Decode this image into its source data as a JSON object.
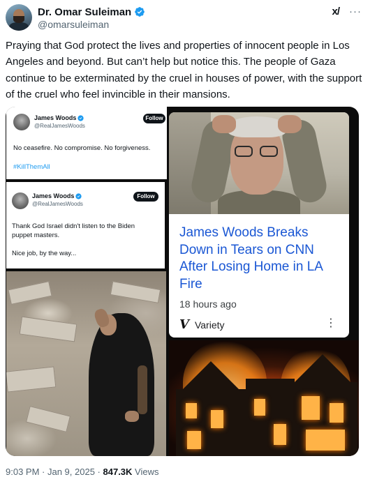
{
  "author": {
    "display_name": "Dr. Omar Suleiman",
    "handle": "@omarsuleiman"
  },
  "header_icons": {
    "grok": "x/",
    "more": "···"
  },
  "tweet": {
    "text": "Praying that God protect the lives and properties of innocent people in Los Angeles and beyond. But can’t help but notice this. The people of Gaza continue to be exterminated by the cruel in houses of power, with the support of the cruel who feel invincible in their mansions."
  },
  "media": {
    "quote1": {
      "name": "James Woods",
      "handle": "@RealJamesWoods",
      "follow": "Follow",
      "text": "No ceasefire. No compromise. No forgiveness.",
      "hashtag": "#KillThemAll"
    },
    "quote2": {
      "name": "James Woods",
      "handle": "@RealJamesWoods",
      "follow": "Follow",
      "text1": "Thank God Israel didn't listen to the Biden puppet masters.",
      "text2": "Nice job, by the way..."
    },
    "news": {
      "headline": "James Woods Breaks Down in Tears on CNN After Losing Home in LA Fire",
      "time": "18 hours ago",
      "source": "Variety",
      "source_logo": "V"
    }
  },
  "footer": {
    "time": "9:03 PM",
    "date": "Jan 9, 2025",
    "views_count": "847.3K",
    "views_label": "Views"
  },
  "colors": {
    "verified_blue": "#1d9bf0",
    "headline_blue": "#1a57d4"
  }
}
